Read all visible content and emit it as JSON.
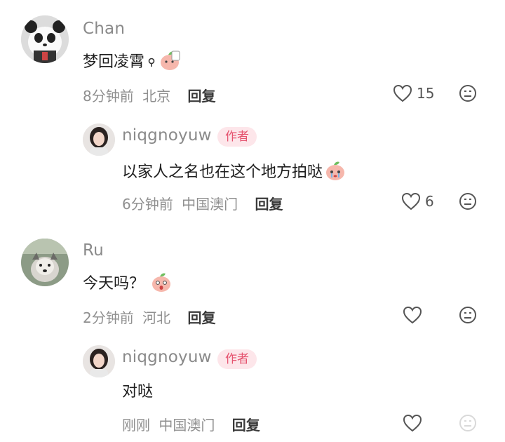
{
  "comments": [
    {
      "username": "Chan",
      "text": "梦回凌霄",
      "time": "8分钟前",
      "location": "北京",
      "reply_label": "回复",
      "like_count": "15",
      "avatar_icon": "panda-avatar",
      "emoji_icons": [
        "small-magnifier-icon",
        "peach-emoji-icon"
      ]
    },
    {
      "username": "niqgnoyuw",
      "tag": "作者",
      "text": "以家人之名也在这个地方拍哒",
      "time": "6分钟前",
      "location": "中国澳门",
      "reply_label": "回复",
      "like_count": "6",
      "avatar_icon": "girl-avatar",
      "emoji_icons": [
        "crying-peach-emoji-icon"
      ]
    },
    {
      "username": "Ru",
      "text": "今天吗？",
      "time": "2分钟前",
      "location": "河北",
      "reply_label": "回复",
      "like_count": "",
      "avatar_icon": "dog-avatar",
      "emoji_icons": [
        "surprised-peach-emoji-icon"
      ]
    },
    {
      "username": "niqgnoyuw",
      "tag": "作者",
      "text": "对哒",
      "time": "刚刚",
      "location": "中国澳门",
      "reply_label": "回复",
      "like_count": "",
      "avatar_icon": "girl-avatar",
      "emoji_icons": []
    }
  ],
  "colors": {
    "author_tag_bg": "#fde6ea",
    "author_tag_text": "#e5536f",
    "meta_text": "#8f8f8f",
    "username_text": "#8a8a8a"
  }
}
